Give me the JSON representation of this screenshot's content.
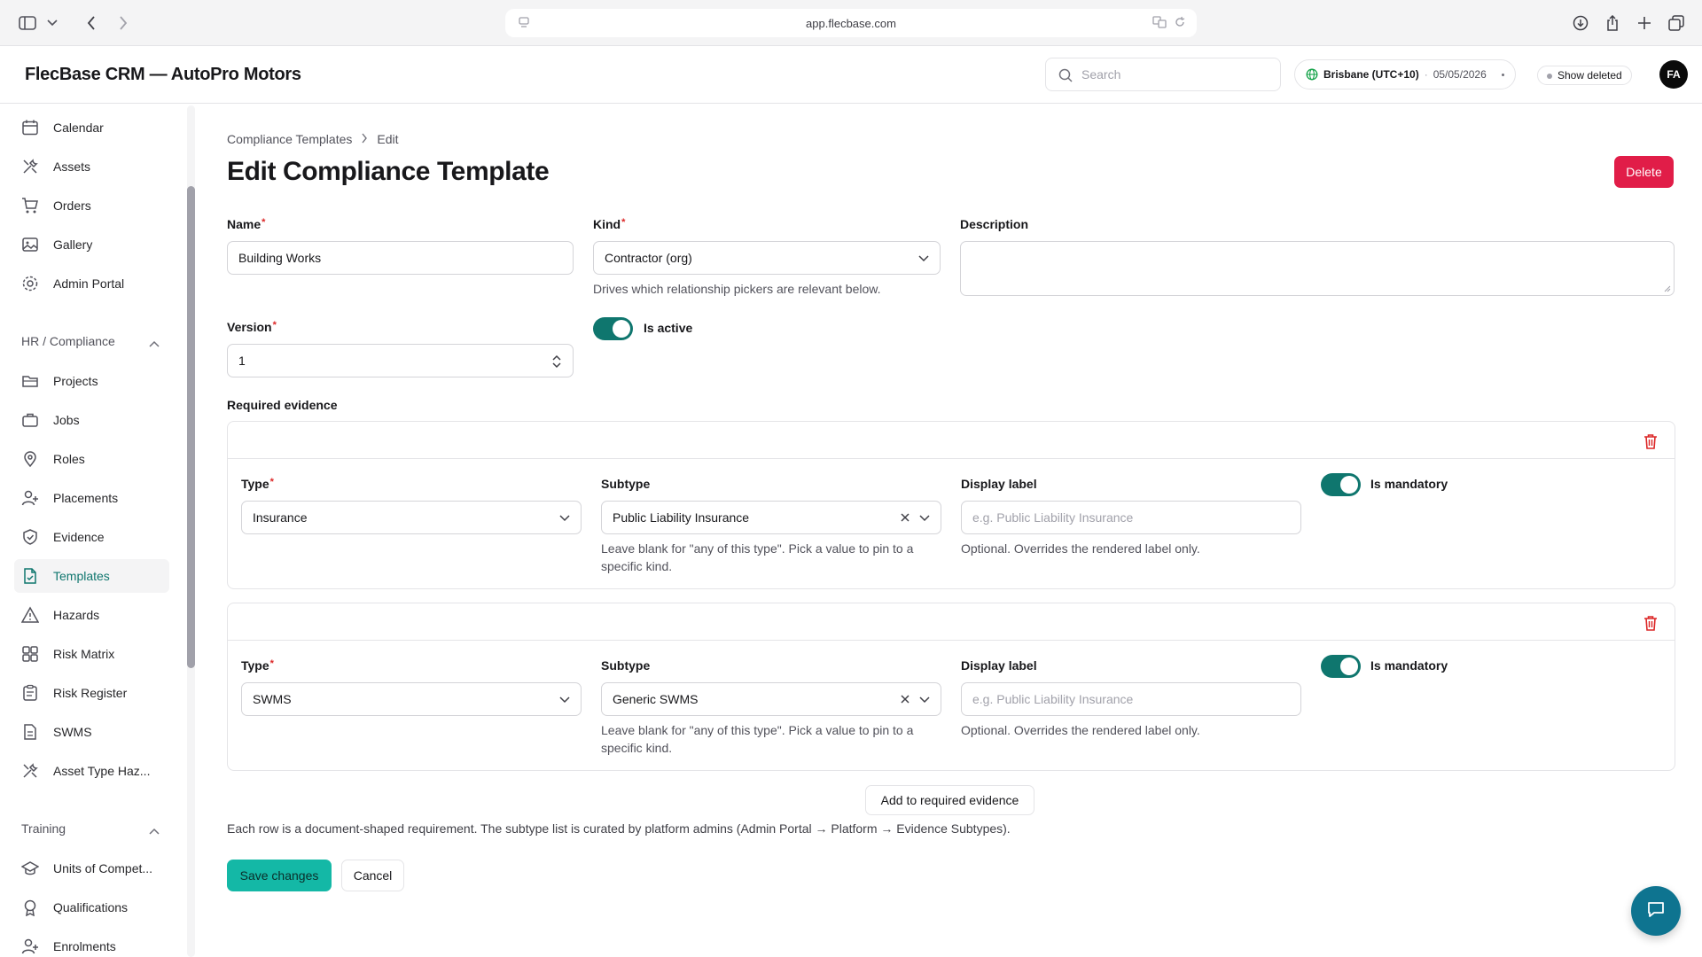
{
  "browser": {
    "url": "app.flecbase.com"
  },
  "header": {
    "title": "FlecBase CRM — AutoPro Motors",
    "search_placeholder": "Search",
    "timezone": "Brisbane (UTC+10)",
    "date": "05/05/2026",
    "show_deleted": "Show deleted",
    "avatar_initials": "FA"
  },
  "sidebar": {
    "top_items": [
      {
        "label": "Calendar",
        "icon": "calendar-icon"
      },
      {
        "label": "Assets",
        "icon": "tools-icon"
      },
      {
        "label": "Orders",
        "icon": "cart-icon"
      },
      {
        "label": "Gallery",
        "icon": "image-icon"
      },
      {
        "label": "Admin Portal",
        "icon": "gear-icon"
      }
    ],
    "group_hr": "HR / Compliance",
    "hr_items": [
      {
        "label": "Projects",
        "icon": "folder-icon"
      },
      {
        "label": "Jobs",
        "icon": "briefcase-icon"
      },
      {
        "label": "Roles",
        "icon": "pin-icon"
      },
      {
        "label": "Placements",
        "icon": "user-plus-icon"
      },
      {
        "label": "Evidence",
        "icon": "shield-check-icon"
      },
      {
        "label": "Templates",
        "icon": "file-check-icon",
        "active": true
      },
      {
        "label": "Hazards",
        "icon": "warning-icon"
      },
      {
        "label": "Risk Matrix",
        "icon": "grid-icon"
      },
      {
        "label": "Risk Register",
        "icon": "clipboard-icon"
      },
      {
        "label": "SWMS",
        "icon": "document-icon"
      },
      {
        "label": "Asset Type Haz...",
        "icon": "tools-icon"
      }
    ],
    "group_training": "Training",
    "training_items": [
      {
        "label": "Units of Compet...",
        "icon": "graduation-cap-icon"
      },
      {
        "label": "Qualifications",
        "icon": "award-icon"
      },
      {
        "label": "Enrolments",
        "icon": "user-plus-icon"
      }
    ]
  },
  "main": {
    "breadcrumb": [
      "Compliance Templates",
      "Edit"
    ],
    "title": "Edit Compliance Template",
    "delete_label": "Delete",
    "form": {
      "name_label": "Name",
      "name_value": "Building Works",
      "kind_label": "Kind",
      "kind_value": "Contractor (org)",
      "kind_help": "Drives which relationship pickers are relevant below.",
      "description_label": "Description",
      "version_label": "Version",
      "version_value": "1",
      "is_active_label": "Is active",
      "is_active": true
    },
    "required_evidence_label": "Required evidence",
    "evidence_rows": [
      {
        "type_label": "Type",
        "type_value": "Insurance",
        "subtype_label": "Subtype",
        "subtype_value": "Public Liability Insurance",
        "subtype_help_1": "Leave blank for \"any of this type\". Pick a value to pin to a",
        "subtype_help_2": "specific kind.",
        "display_label": "Display label",
        "display_placeholder": "e.g. Public Liability Insurance",
        "display_help": "Optional. Overrides the rendered label only.",
        "mandatory_label": "Is mandatory",
        "mandatory": true
      },
      {
        "type_label": "Type",
        "type_value": "SWMS",
        "subtype_label": "Subtype",
        "subtype_value": "Generic SWMS",
        "subtype_help_1": "Leave blank for \"any of this type\". Pick a value to pin to a",
        "subtype_help_2": "specific kind.",
        "display_label": "Display label",
        "display_placeholder": "e.g. Public Liability Insurance",
        "display_help": "Optional. Overrides the rendered label only.",
        "mandatory_label": "Is mandatory",
        "mandatory": true
      }
    ],
    "add_evidence_label": "Add to required evidence",
    "footnote": "Each row is a document-shaped requirement. The subtype list is curated by platform admins (Admin Portal → Platform → Evidence Subtypes).",
    "save_label": "Save changes",
    "cancel_label": "Cancel"
  },
  "colors": {
    "accent": "#0f766e",
    "primary_button": "#14b8a6",
    "danger": "#e11d48"
  }
}
